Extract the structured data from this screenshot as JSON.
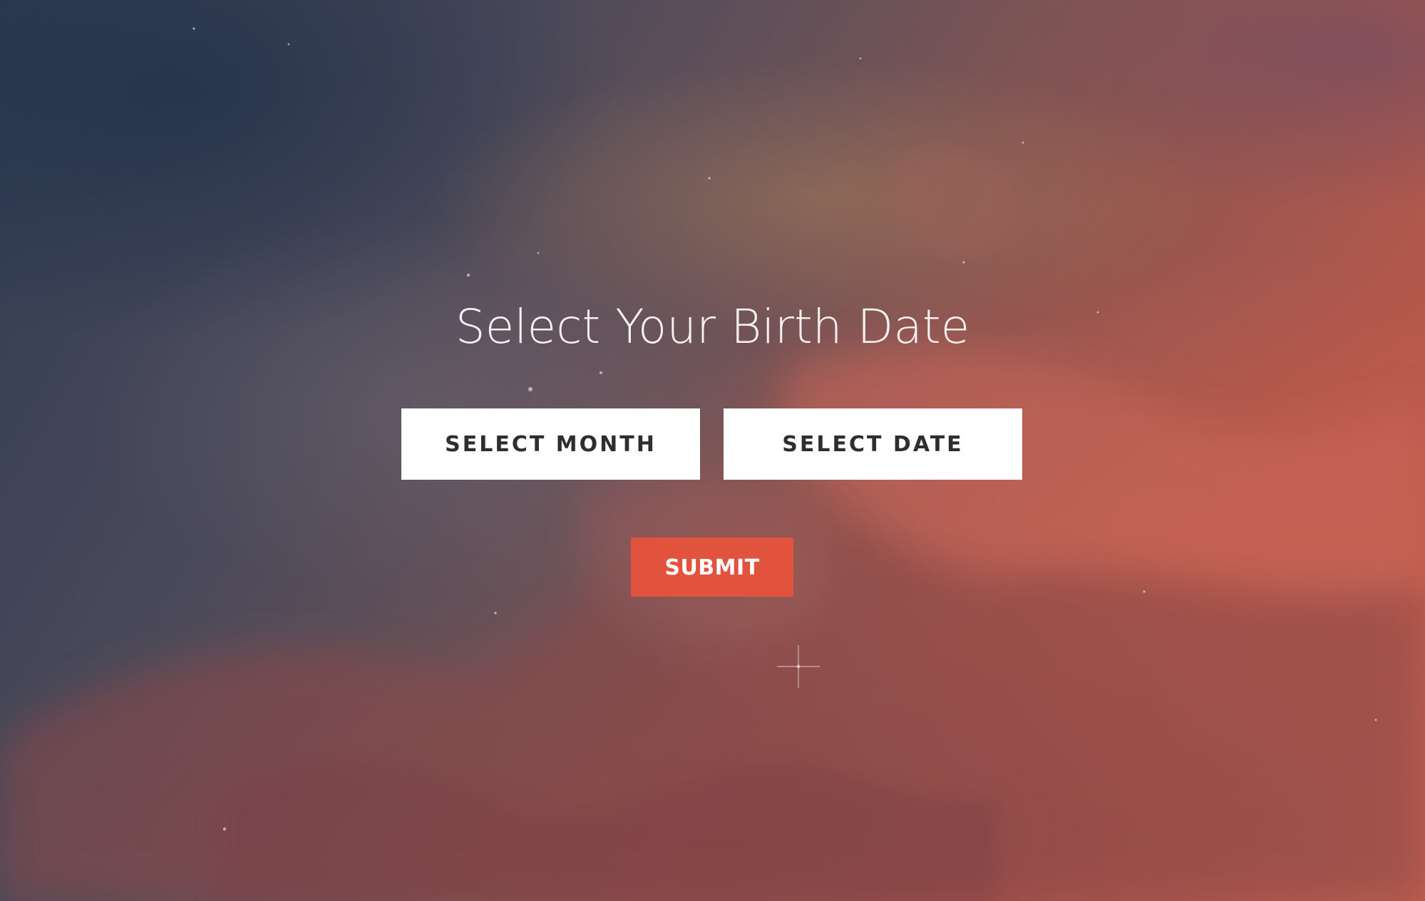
{
  "page": {
    "title": "Select Your Birth Date"
  },
  "form": {
    "month_button_label": "SELECT MONTH",
    "date_button_label": "SELECT DATE",
    "submit_label": "SUBMIT"
  },
  "colors": {
    "accent": "#e2533e",
    "button_background": "#ffffff",
    "button_text": "#2e2e2e",
    "title_text": "#f6f1f0"
  }
}
